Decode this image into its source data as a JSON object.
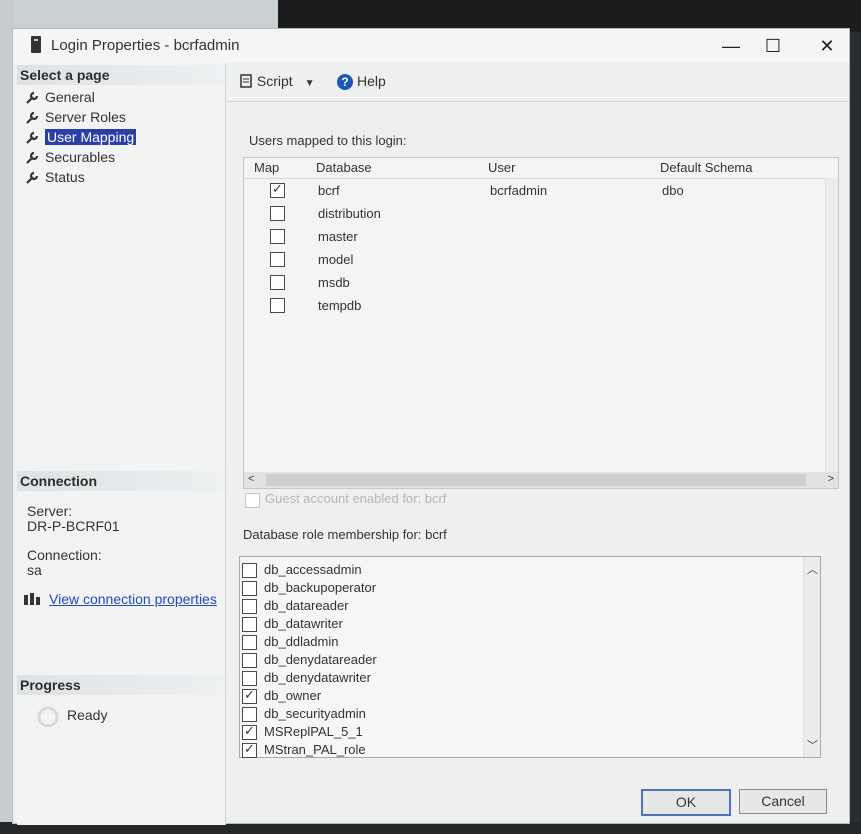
{
  "window": {
    "title": "Login Properties - bcrfadmin",
    "controls": {
      "minimize": "—",
      "maximize": "☐",
      "close": "✕"
    }
  },
  "sidebar": {
    "header": "Select a page",
    "items": [
      {
        "label": "General",
        "selected": false
      },
      {
        "label": "Server Roles",
        "selected": false
      },
      {
        "label": "User Mapping",
        "selected": true
      },
      {
        "label": "Securables",
        "selected": false
      },
      {
        "label": "Status",
        "selected": false
      }
    ]
  },
  "connection": {
    "header": "Connection",
    "server_label": "Server:",
    "server_value": "DR-P-BCRF01",
    "connection_label": "Connection:",
    "connection_value": "sa",
    "view_link": "View connection properties"
  },
  "progress": {
    "header": "Progress",
    "status": "Ready"
  },
  "toolbar": {
    "script_label": "Script",
    "help_label": "Help"
  },
  "mapping": {
    "label": "Users mapped to this login:",
    "columns": [
      "Map",
      "Database",
      "User",
      "Default Schema"
    ],
    "rows": [
      {
        "checked": true,
        "database": "bcrf",
        "user": "bcrfadmin",
        "schema": "dbo"
      },
      {
        "checked": false,
        "database": "distribution",
        "user": "",
        "schema": ""
      },
      {
        "checked": false,
        "database": "master",
        "user": "",
        "schema": ""
      },
      {
        "checked": false,
        "database": "model",
        "user": "",
        "schema": ""
      },
      {
        "checked": false,
        "database": "msdb",
        "user": "",
        "schema": ""
      },
      {
        "checked": false,
        "database": "tempdb",
        "user": "",
        "schema": ""
      }
    ]
  },
  "guest_label": "Guest account enabled for: bcrf",
  "roles": {
    "label": "Database role membership for: bcrf",
    "items": [
      {
        "name": "db_accessadmin",
        "checked": false
      },
      {
        "name": "db_backupoperator",
        "checked": false
      },
      {
        "name": "db_datareader",
        "checked": false
      },
      {
        "name": "db_datawriter",
        "checked": false
      },
      {
        "name": "db_ddladmin",
        "checked": false
      },
      {
        "name": "db_denydatareader",
        "checked": false
      },
      {
        "name": "db_denydatawriter",
        "checked": false
      },
      {
        "name": "db_owner",
        "checked": true
      },
      {
        "name": "db_securityadmin",
        "checked": false
      },
      {
        "name": "MSReplPAL_5_1",
        "checked": true
      },
      {
        "name": "MStran_PAL_role",
        "checked": true
      }
    ]
  },
  "buttons": {
    "ok": "OK",
    "cancel": "Cancel"
  }
}
